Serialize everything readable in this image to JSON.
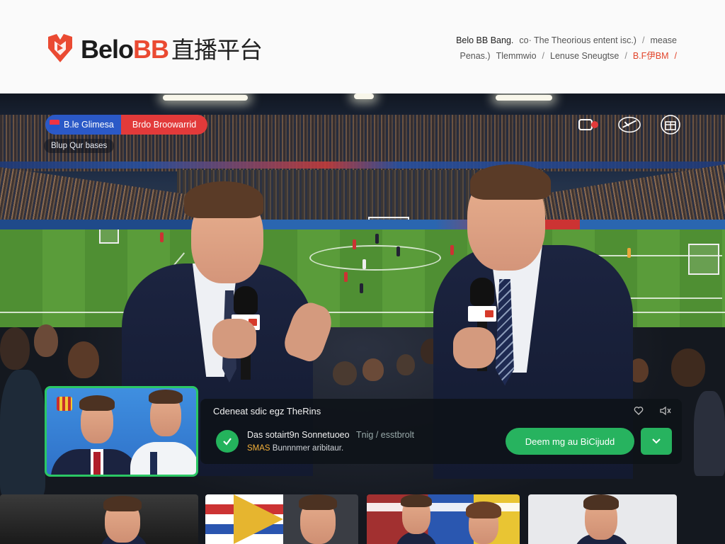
{
  "brand": {
    "name_part1": "Belo",
    "name_part2": "BB",
    "name_cn": "直播平台"
  },
  "topnav": {
    "row1": [
      "Belo BB Bang.",
      "co· The Theorious entent isc.)",
      "/",
      "mease"
    ],
    "row2": [
      "Penas.)",
      "Tlemmwio",
      "/",
      "Lenuse Sneugtse",
      "/",
      "B.F伊BM",
      "/"
    ]
  },
  "live_badge": {
    "primary": "B.le Glimesa",
    "secondary": "Brdo Broowarrid"
  },
  "sub_badge": "Blup Qur bases",
  "card": {
    "title": "Cdeneat sdic egz TheRins",
    "line1": "Das sotairt9n Sonnetuoeo",
    "line1_muted": "Tnig / esstbrolt",
    "line2_prefix": "SMAS",
    "line2_rest": "Bunnnmer aribitaur.",
    "cta_label": "Deem mg au BiCijudd"
  },
  "colors": {
    "brand_red": "#ea4a32",
    "accent_green": "#27b35f",
    "pip_border": "#2bc764",
    "badge_blue": "#2b59c7",
    "badge_red": "#e23a3a"
  },
  "icons": [
    "tv-record-icon",
    "no-whistle-icon",
    "gift-icon",
    "heart-icon",
    "mute-icon",
    "check-icon",
    "chevron-down-icon"
  ]
}
